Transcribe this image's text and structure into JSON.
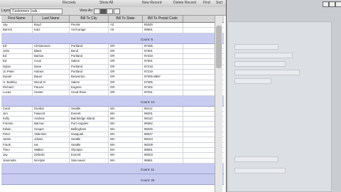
{
  "toolbar": {
    "items": [
      "Records",
      "Show All",
      "New Record",
      "Delete Record",
      "Find",
      "Sort"
    ]
  },
  "layoutbar": {
    "layout_label": "Layout:",
    "layout_value": "Customers (sub...",
    "view_label": "View As:"
  },
  "grid": {
    "headers": [
      "First Name",
      "Last Name",
      "Bill To City",
      "Bill To State",
      "Bill To Postal Code",
      ""
    ],
    "groups": [
      {
        "rows": [
          [
            "Jay",
            "Boyd",
            "Peoria",
            "AZ",
            "85345",
            ""
          ],
          [
            "Barrett",
            "Katz",
            "Anchorage",
            "AK",
            "99501",
            ""
          ]
        ],
        "count": "Count: 5"
      },
      {
        "rows": [
          [
            "Ed",
            "Christenson",
            "Portland",
            "OR",
            "97205",
            ""
          ],
          [
            "John",
            "Black",
            "Bend",
            "OR",
            "97501",
            ""
          ],
          [
            "Ed",
            "Barlow",
            "Portland",
            "OR",
            "97233",
            ""
          ],
          [
            "Ed",
            "Coon",
            "Salem",
            "OR",
            "97301",
            ""
          ],
          [
            "Dylan",
            "Dane",
            "Portland",
            "OR",
            "97218",
            ""
          ],
          [
            "Jo Peter",
            "Haines",
            "Portland",
            "OR",
            "97219",
            ""
          ],
          [
            "Daniel",
            "Bauer",
            "Beaverton",
            "OR",
            "97005-8897",
            ""
          ],
          [
            "H. Barkley",
            "Wood III",
            "Salem",
            "OR",
            "97305",
            ""
          ],
          [
            "Richard",
            "Pauvre",
            "Eugene",
            "OR",
            "97402",
            ""
          ],
          [
            "Lucas",
            "Hunter",
            "Hood River",
            "OR",
            "97031",
            ""
          ]
        ],
        "count": "Count: 10"
      },
      {
        "rows": [
          [
            "Carol",
            "Dunbar",
            "Seattle",
            "WA",
            "98112",
            ""
          ],
          [
            "Jen",
            "Fawcett",
            "Everett",
            "WA",
            "98201",
            ""
          ],
          [
            "Kelly",
            "Andrew",
            "Bainbridge Island",
            "WA",
            "98110",
            ""
          ],
          [
            "Frannie",
            "Barrow",
            "Port Angeles",
            "WA",
            "98362",
            ""
          ],
          [
            "Edwin",
            "Hooper",
            "Bellingham",
            "WA",
            "98225",
            ""
          ],
          [
            "Peter",
            "Valentine",
            "Issaquah",
            "WA",
            "98027",
            ""
          ],
          [
            "Jamie",
            "Jobins",
            "Seattle",
            "WA",
            "98104",
            ""
          ],
          [
            "Frank",
            "Ian",
            "Seattle",
            "WA",
            "98109",
            ""
          ],
          [
            "Theo",
            "Walker",
            "Olympia",
            "WA",
            "98501",
            ""
          ],
          [
            "Jay",
            "Zelinski",
            "Everett",
            "WA",
            "98203",
            ""
          ],
          [
            "Jeannette",
            "McAlpin",
            "Vancouver",
            "WA",
            "98661",
            ""
          ]
        ],
        "count": "Count: 11"
      }
    ],
    "final_count": "Count: 26"
  },
  "colors": {
    "summary": "#c8ccf0",
    "background": "#8a8f96"
  }
}
